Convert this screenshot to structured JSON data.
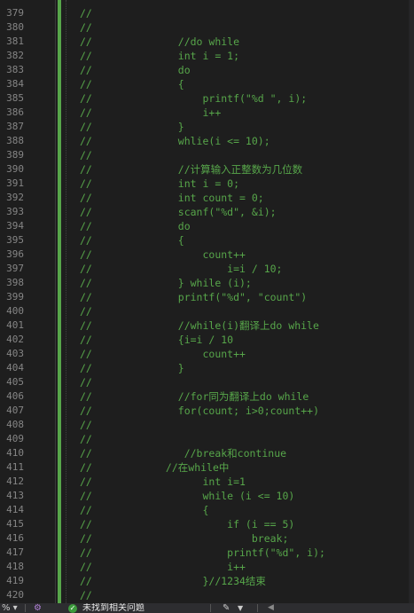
{
  "editor": {
    "first_line_number": 379,
    "lines": [
      {
        "num": "379",
        "indent": 0,
        "text": "//"
      },
      {
        "num": "380",
        "indent": 0,
        "text": "//"
      },
      {
        "num": "381",
        "indent": 0,
        "text": "//              //do while"
      },
      {
        "num": "382",
        "indent": 0,
        "text": "//              int i = 1;"
      },
      {
        "num": "383",
        "indent": 0,
        "text": "//              do"
      },
      {
        "num": "384",
        "indent": 0,
        "text": "//              {"
      },
      {
        "num": "385",
        "indent": 0,
        "text": "//                  printf(\"%d \", i);"
      },
      {
        "num": "386",
        "indent": 0,
        "text": "//                  i++"
      },
      {
        "num": "387",
        "indent": 0,
        "text": "//              }"
      },
      {
        "num": "388",
        "indent": 0,
        "text": "//              whlie(i <= 10);"
      },
      {
        "num": "389",
        "indent": 0,
        "text": "//"
      },
      {
        "num": "390",
        "indent": 0,
        "text": "//              //计算输入正整数为几位数"
      },
      {
        "num": "391",
        "indent": 0,
        "text": "//              int i = 0;"
      },
      {
        "num": "392",
        "indent": 0,
        "text": "//              int count = 0;"
      },
      {
        "num": "393",
        "indent": 0,
        "text": "//              scanf(\"%d\", &i);"
      },
      {
        "num": "394",
        "indent": 0,
        "text": "//              do"
      },
      {
        "num": "395",
        "indent": 0,
        "text": "//              {"
      },
      {
        "num": "396",
        "indent": 0,
        "text": "//                  count++"
      },
      {
        "num": "397",
        "indent": 0,
        "text": "//                      i=i / 10;"
      },
      {
        "num": "398",
        "indent": 0,
        "text": "//              } while (i);"
      },
      {
        "num": "399",
        "indent": 0,
        "text": "//              printf(\"%d\", \"count\")"
      },
      {
        "num": "400",
        "indent": 0,
        "text": "//"
      },
      {
        "num": "401",
        "indent": 0,
        "text": "//              //while(i)翻译上do while"
      },
      {
        "num": "402",
        "indent": 0,
        "text": "//              {i=i / 10"
      },
      {
        "num": "403",
        "indent": 0,
        "text": "//                  count++"
      },
      {
        "num": "404",
        "indent": 0,
        "text": "//              }"
      },
      {
        "num": "405",
        "indent": 0,
        "text": "//"
      },
      {
        "num": "406",
        "indent": 0,
        "text": "//              //for同为翻译上do while"
      },
      {
        "num": "407",
        "indent": 0,
        "text": "//              for(count; i>0;count++)"
      },
      {
        "num": "408",
        "indent": 0,
        "text": "//"
      },
      {
        "num": "409",
        "indent": 0,
        "text": "//"
      },
      {
        "num": "410",
        "indent": 0,
        "text": "//               //break和continue"
      },
      {
        "num": "411",
        "indent": 0,
        "text": "//            //在while中"
      },
      {
        "num": "412",
        "indent": 0,
        "text": "//                  int i=1"
      },
      {
        "num": "413",
        "indent": 0,
        "text": "//                  while (i <= 10)"
      },
      {
        "num": "414",
        "indent": 0,
        "text": "//                  {"
      },
      {
        "num": "415",
        "indent": 0,
        "text": "//                      if (i == 5)"
      },
      {
        "num": "416",
        "indent": 0,
        "text": "//                          break;"
      },
      {
        "num": "417",
        "indent": 0,
        "text": "//                      printf(\"%d\", i);"
      },
      {
        "num": "418",
        "indent": 0,
        "text": "//                      i++"
      },
      {
        "num": "419",
        "indent": 0,
        "text": "//                  }//1234结束"
      },
      {
        "num": "420",
        "indent": 0,
        "text": "//"
      }
    ]
  },
  "colors": {
    "background": "#1e1e1e",
    "line_number": "#858585",
    "comment": "#57a64a",
    "change_bar": "#57a64a"
  },
  "statusbar": {
    "zoom": "% ▾",
    "settings_icon": "gear-icon",
    "ok_icon": "check-circle-icon",
    "issues_text": "未找到相关问题",
    "brush_icon": "brush-icon",
    "dropdown_icon": "chevron-down-icon",
    "nav_left_icon": "arrow-left-icon"
  }
}
